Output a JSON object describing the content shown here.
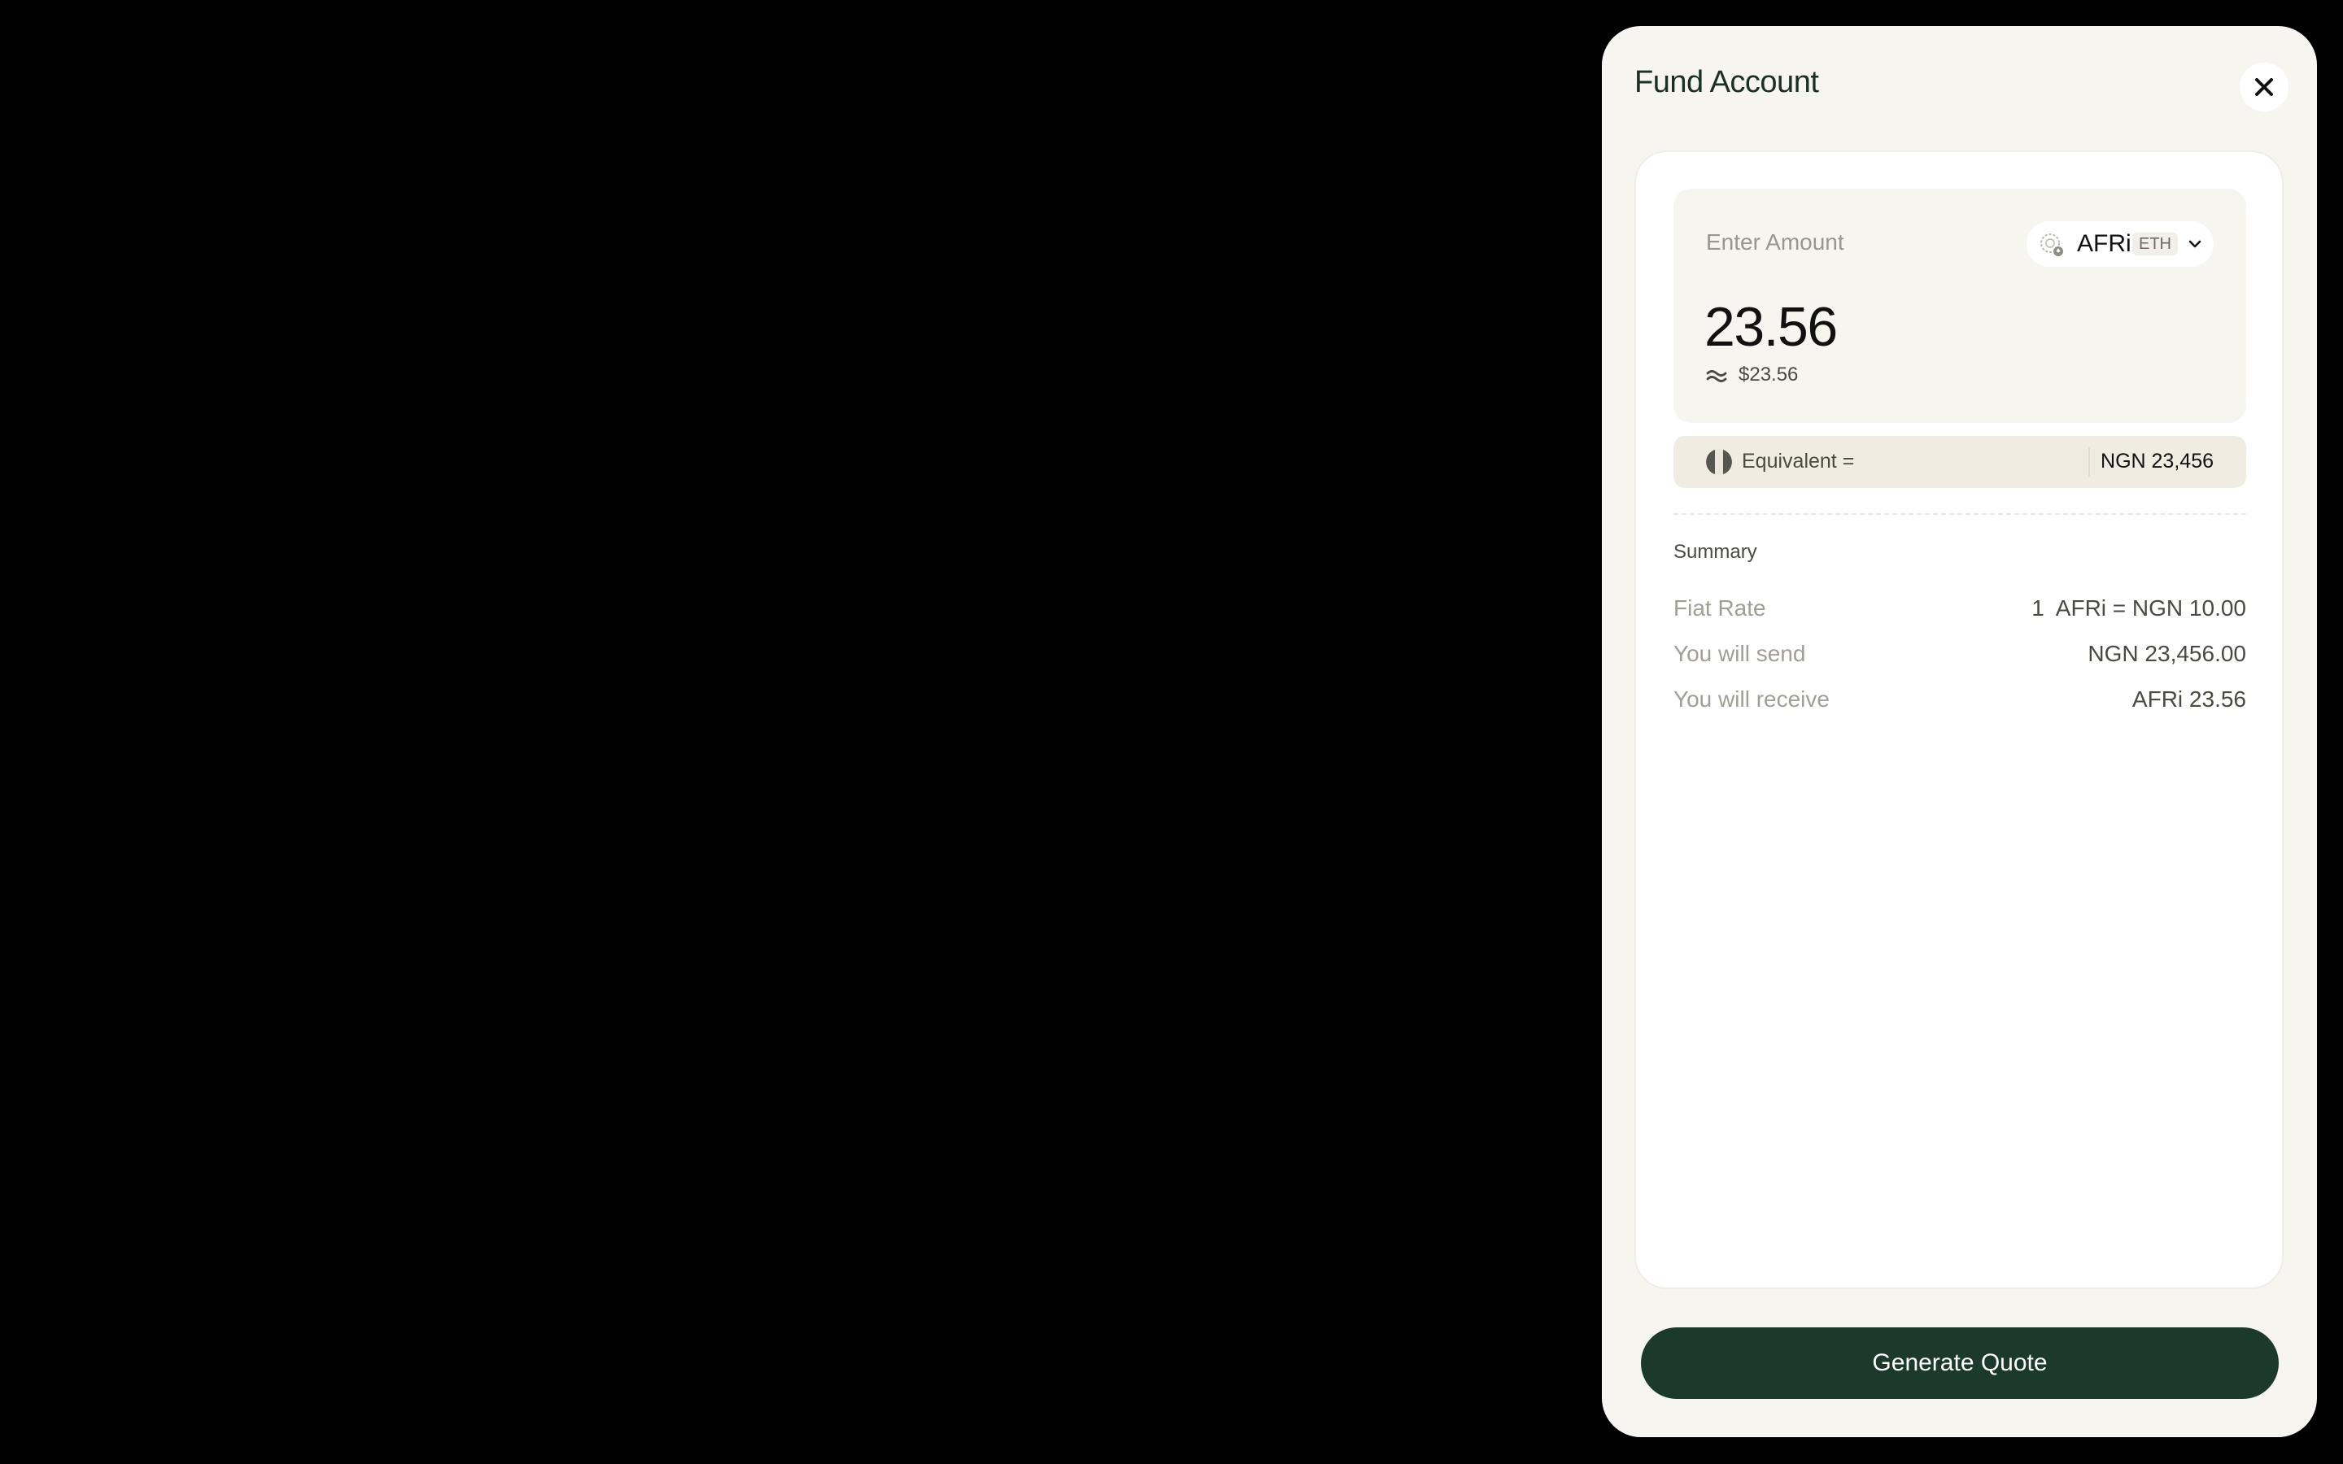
{
  "dialog": {
    "title": "Fund Account",
    "close_icon": "close-icon"
  },
  "amount": {
    "label": "Enter Amount",
    "value": "23.56",
    "approx_usd": "$23.56",
    "token": {
      "symbol": "AFRi",
      "network": "ETH",
      "icon": "token-icon"
    }
  },
  "equivalent": {
    "label": "Equivalent =",
    "value": "NGN 23,456",
    "flag_icon": "nigeria-flag-icon"
  },
  "summary": {
    "title": "Summary",
    "rows": [
      {
        "label": "Fiat Rate",
        "value": "1  AFRi = NGN 10.00"
      },
      {
        "label": "You will send",
        "value": "NGN 23,456.00"
      },
      {
        "label": "You will receive",
        "value": "AFRi 23.56"
      }
    ]
  },
  "actions": {
    "generate_label": "Generate Quote"
  },
  "colors": {
    "page_background": "#000000",
    "panel_background": "#f6f5f0",
    "primary_button": "#1b3a2b",
    "title_text": "#1b2f25"
  }
}
